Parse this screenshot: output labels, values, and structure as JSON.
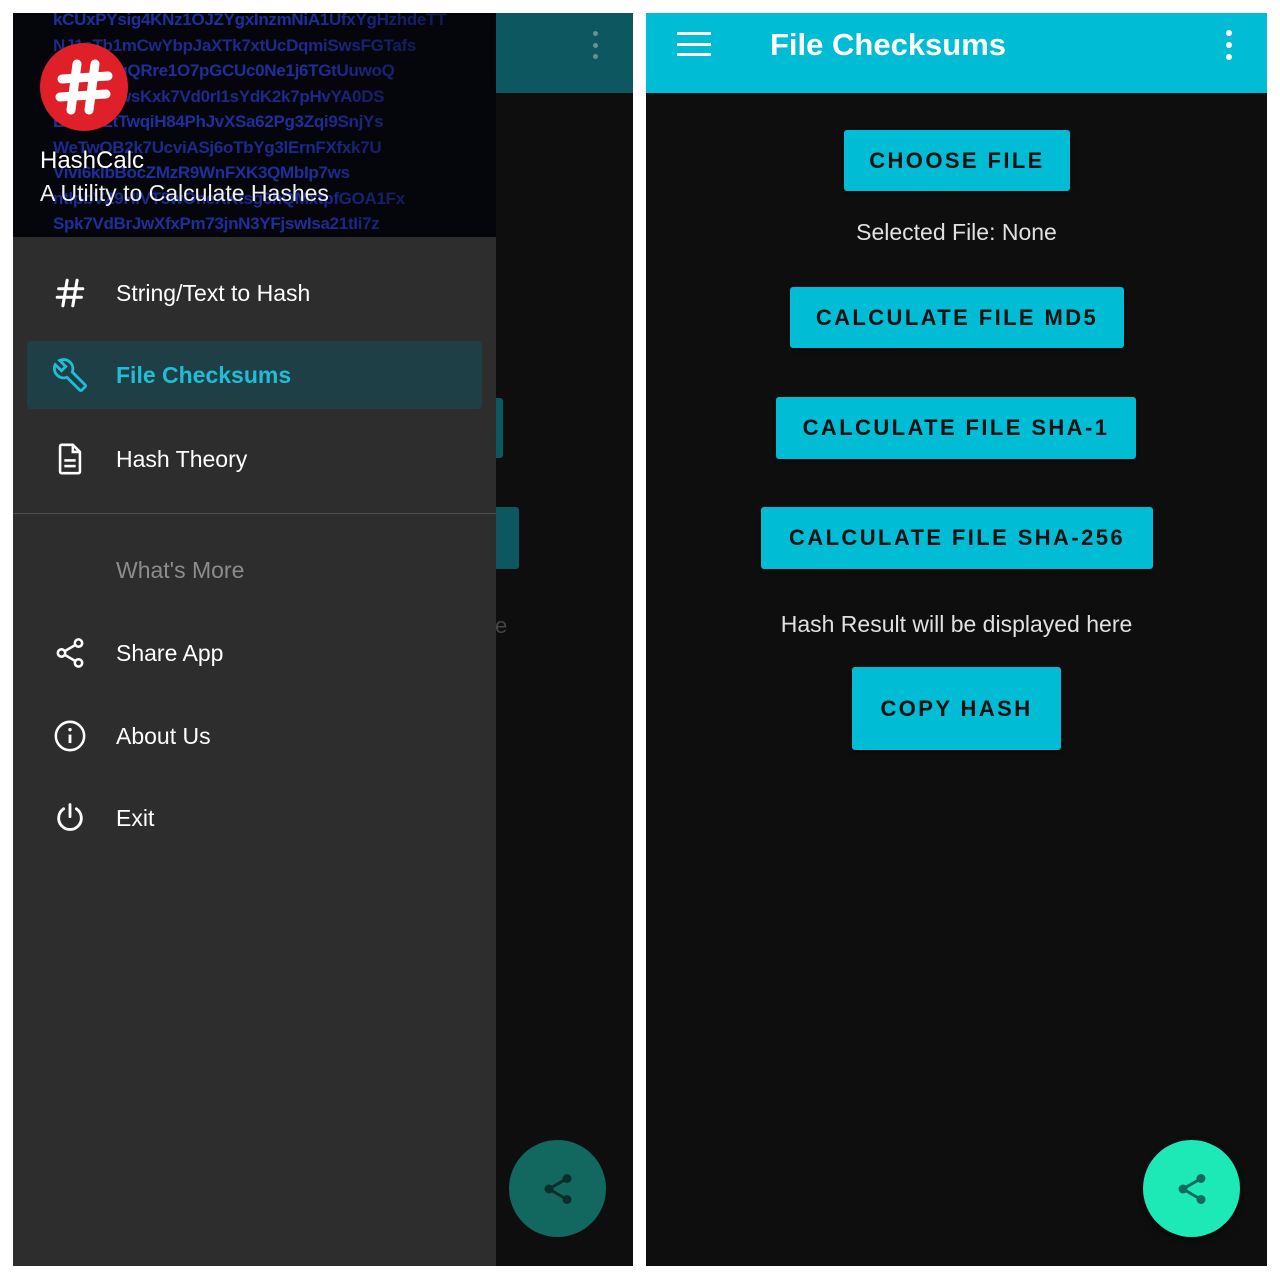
{
  "drawer": {
    "header": {
      "app_name": "HashCalc",
      "subtitle": "A Utility to Calculate Hashes",
      "logo_icon": "hash-logo-icon",
      "background_hash_strings": [
        "kCUxPYsig4KNz1OJZYgxInzmNiA1UfxYgHzhdeTT",
        "NJ1sTb1mCwYbpJaXTk7xtUcDqmiSwsFGTafs",
        "FXKxQ8qQRre1O7pGCUc0Ne1j6TGtUuwoQ",
        "1zREWewsKxk7Vd0rI1sYdK2k7pHvYA0DS",
        "EASjK2tTwqiH84PhJvXSa62Pg3Zqi9SnjYs",
        "WeTwOB2k7UcviASj6oTbYg3lErnFXfxk7U",
        "Vivi6klbBocZMzR9WnFXK3QMbIp7ws",
        "ntlpbVZ9HIVT5wOneXKtsg6hQMxtpfGOA1Fx",
        "Spk7VdBrJwXfxPm73jnN3YFjswIsa21tIi7z"
      ]
    },
    "nav_items": [
      {
        "label": "String/Text to Hash",
        "icon": "hash-icon"
      },
      {
        "label": "File Checksums",
        "icon": "wrench-icon",
        "active": true
      },
      {
        "label": "Hash Theory",
        "icon": "document-icon"
      }
    ],
    "section_label": "What's More",
    "more_items": [
      {
        "label": "Share App",
        "icon": "share-icon"
      },
      {
        "label": "About Us",
        "icon": "info-icon"
      },
      {
        "label": "Exit",
        "icon": "power-icon"
      }
    ]
  },
  "background_screen": {
    "partial_text": "e",
    "fab_icon": "share-icon"
  },
  "main": {
    "toolbar": {
      "title": "File Checksums",
      "menu_icon": "hamburger-menu-icon",
      "overflow_icon": "more-vert-icon"
    },
    "choose_file_label": "CHOOSE FILE",
    "selected_file_text": "Selected File: None",
    "md5_label": "CALCULATE FILE MD5",
    "sha1_label": "CALCULATE FILE SHA-1",
    "sha256_label": "CALCULATE FILE SHA-256",
    "result_text": "Hash Result will be displayed here",
    "copy_hash_label": "COPY HASH",
    "fab_icon": "share-icon"
  },
  "colors": {
    "primary": "#00bcd4",
    "accent": "#1de9b6",
    "drawer_bg": "#2d2d2d",
    "screen_bg": "#0e0e0e",
    "active_item_text": "#21bcd6",
    "logo_red": "#e02028"
  }
}
